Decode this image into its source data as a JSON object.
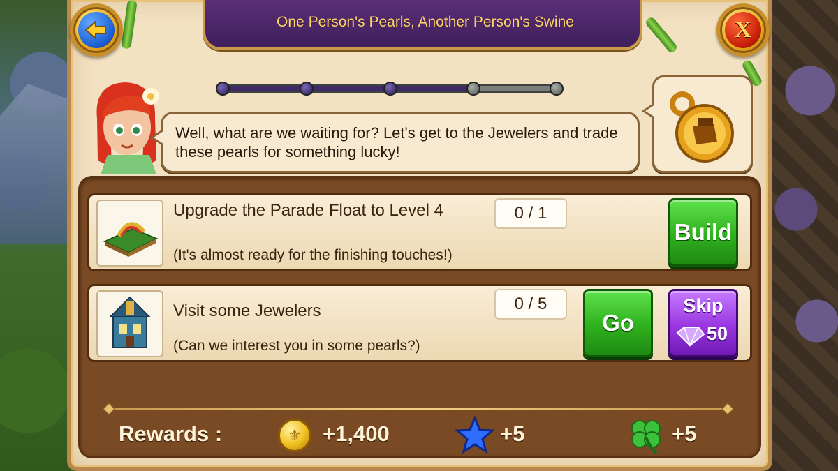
{
  "header": {
    "title": "One Person's Pearls, Another Person's Swine"
  },
  "buttons": {
    "back_icon": "back-arrow-icon",
    "close_label": "X"
  },
  "quest_progress": {
    "total_steps": 5,
    "completed_steps": 3,
    "current_step": 4
  },
  "dialogue": {
    "text": "Well, what are we waiting for? Let's get to the Jewelers and trade these pearls for something lucky!"
  },
  "tasks": [
    {
      "title": "Upgrade the Parade Float to Level 4",
      "subtitle": "(It's almost ready for the finishing touches!)",
      "count": "0 / 1",
      "action_label": "Build"
    },
    {
      "title": "Visit some Jewelers",
      "subtitle": "(Can we interest you in some pearls?)",
      "count": "0 / 5",
      "action_label": "Go",
      "skip_label": "Skip",
      "skip_cost": "50"
    }
  ],
  "rewards": {
    "label": "Rewards :",
    "coins": "+1,400",
    "stars": "+5",
    "clovers": "+5"
  },
  "colors": {
    "header_purple": "#4a2566",
    "title_gold": "#ffd46a",
    "build_green": "#2fb01e",
    "skip_purple": "#9a36e0",
    "panel_brown": "#7a4a24"
  }
}
